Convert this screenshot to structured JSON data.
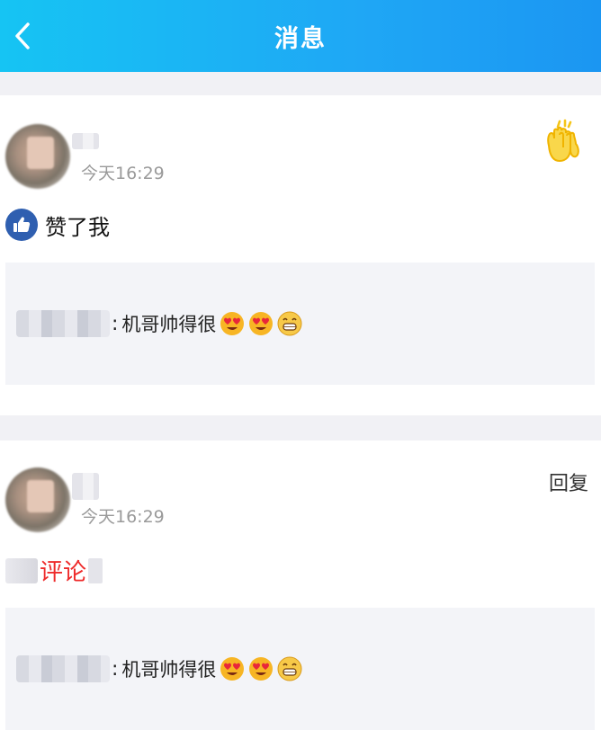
{
  "header": {
    "title": "消息"
  },
  "messages": [
    {
      "time": "今天16:29",
      "action": "赞了我",
      "quote": {
        "colon": ":",
        "text": "机哥帅得很"
      }
    },
    {
      "time": "今天16:29",
      "reply_label": "回复",
      "comment_label": "评论",
      "quote": {
        "colon": ":",
        "text": "机哥帅得很"
      }
    }
  ],
  "icons": {
    "back": "chevron-left-icon",
    "clap": "high-five-icon",
    "like": "thumbs-up-icon",
    "emoji_1": "heart-eyes-emoji",
    "emoji_2": "grinning-emoji"
  },
  "colors": {
    "header_start": "#16c4f3",
    "header_end": "#1b96f2",
    "like_badge": "#2f5fb0",
    "comment_red": "#ee2a2a",
    "clap_yellow": "#f5c518"
  }
}
